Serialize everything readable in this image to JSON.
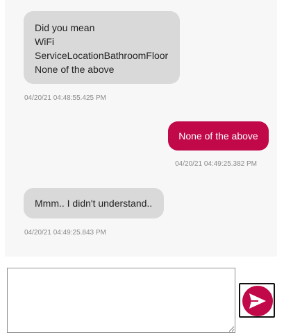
{
  "conversation": {
    "messages": [
      {
        "sender": "bot",
        "lines": [
          "Did you mean",
          "WiFi",
          "ServiceLocationBathroomFloor",
          "None of the above"
        ],
        "timestamp": "04/20/21 04:48:55.425 PM"
      },
      {
        "sender": "user",
        "text": "None of the above",
        "timestamp": "04/20/21 04:49:25.382 PM"
      },
      {
        "sender": "bot",
        "text": "Mmm.. I didn't understand..",
        "timestamp": "04/20/21 04:49:25.843 PM"
      }
    ]
  },
  "composer": {
    "input_value": "",
    "send_icon": "send-arrow-icon"
  },
  "colors": {
    "accent": "#c1094a",
    "bot_bubble": "#d9d9d9",
    "panel_background": "#f7f7f7"
  }
}
